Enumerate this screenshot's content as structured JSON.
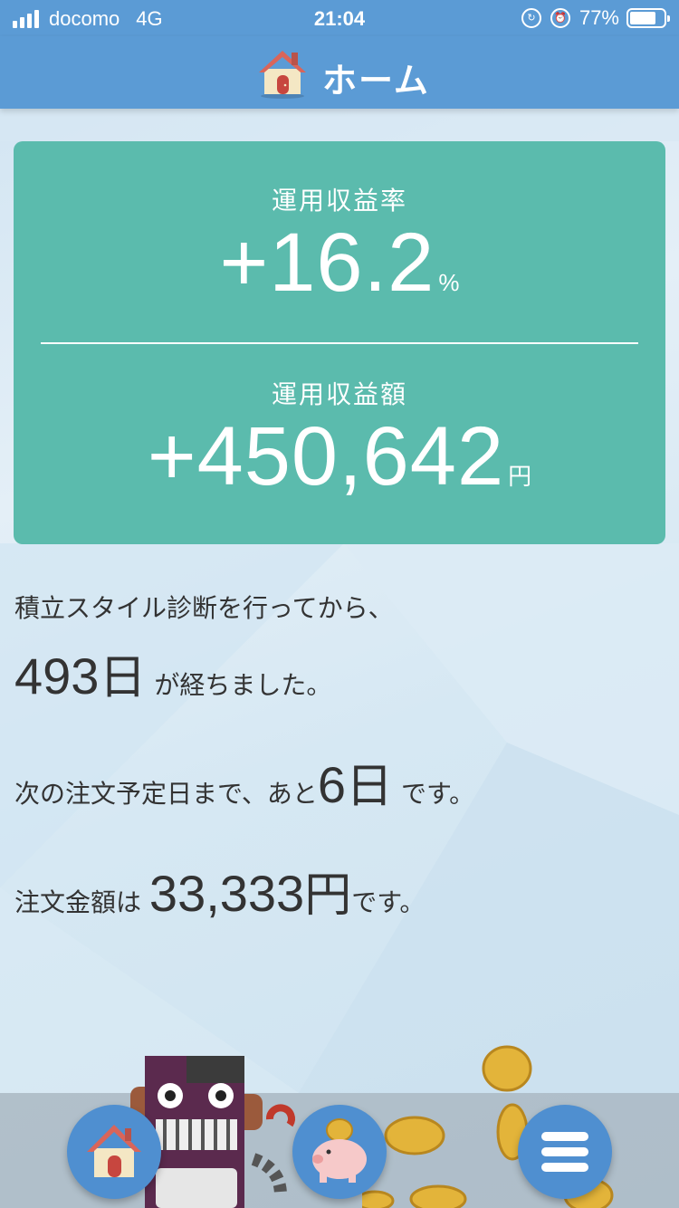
{
  "status_bar": {
    "carrier": "docomo",
    "network": "4G",
    "time": "21:04",
    "battery_text": "77%",
    "battery_level": 0.77
  },
  "header": {
    "title": "ホーム",
    "icon": "house-icon"
  },
  "summary": {
    "return_rate_label": "運用収益率",
    "return_rate_value": "+16.2",
    "return_rate_unit": "%",
    "return_amount_label": "運用収益額",
    "return_amount_value": "+450,642",
    "return_amount_unit": "円"
  },
  "diagnosis": {
    "line1": "積立スタイル診断を行ってから、",
    "days_number": "493",
    "days_unit": "日",
    "days_suffix": "が経ちました。"
  },
  "next_order": {
    "prefix": "次の注文予定日まで、あと",
    "days_number": "6",
    "days_unit": "日",
    "suffix": "です。"
  },
  "order_amount": {
    "prefix": "注文金額は",
    "amount": "33,333",
    "unit": "円",
    "suffix": "です。"
  },
  "bottom_nav": {
    "items": [
      {
        "icon": "house-icon"
      },
      {
        "icon": "piggy-bank-icon"
      },
      {
        "icon": "menu-icon"
      }
    ]
  },
  "colors": {
    "bar": "#5b9bd5",
    "card": "#5bbbad",
    "fab": "#4f8fd0"
  }
}
